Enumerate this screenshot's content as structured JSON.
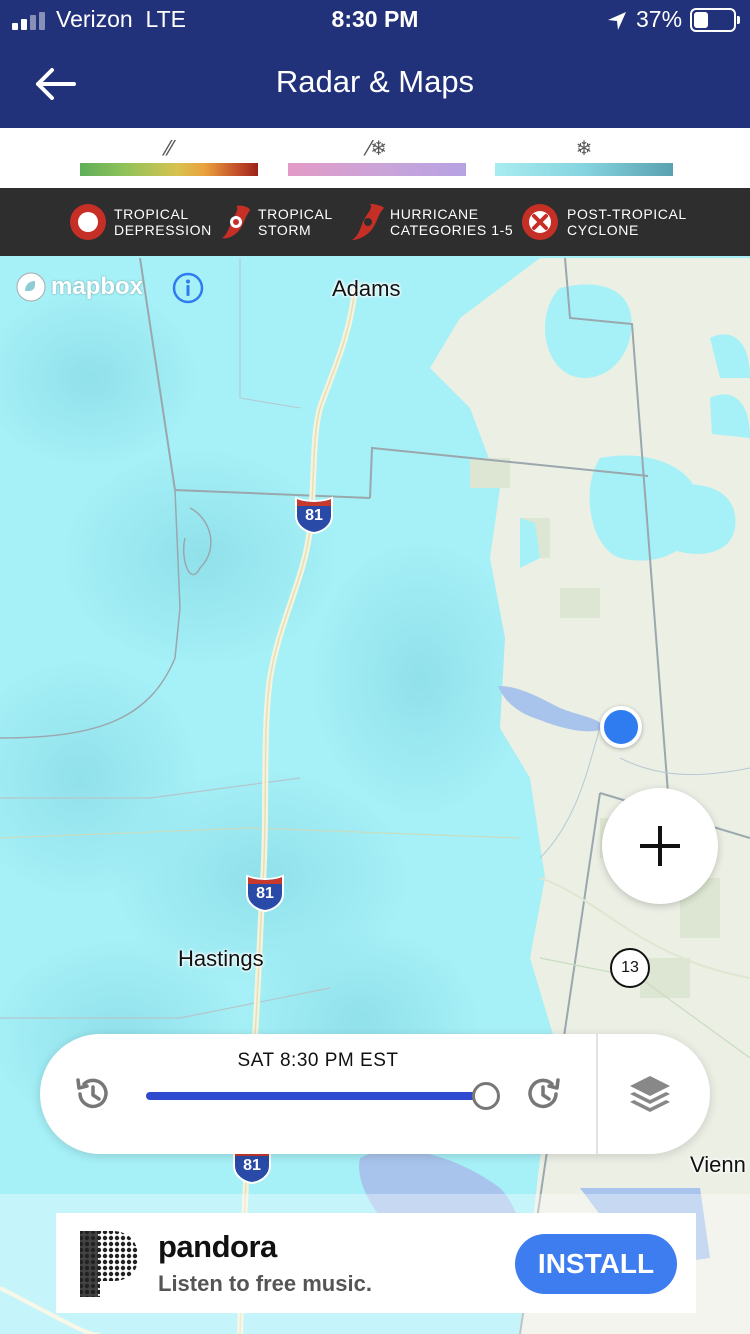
{
  "status_bar": {
    "carrier": "Verizon",
    "network": "LTE",
    "time": "8:30 PM",
    "battery": "37%"
  },
  "header": {
    "title": "Radar & Maps",
    "back_icon": "arrow-left-icon"
  },
  "precip_legend": [
    {
      "icon": "rain-icon",
      "symbol": "⁄⁄",
      "colors": [
        "#5fae5a",
        "#d8c24f",
        "#9b2319"
      ]
    },
    {
      "icon": "mix-icon",
      "symbol": "⁄❄",
      "colors": [
        "#e39ac6",
        "#b6a2e3"
      ]
    },
    {
      "icon": "snow-icon",
      "symbol": "❄",
      "colors": [
        "#a8ecf0",
        "#5aa1b1"
      ]
    }
  ],
  "storm_legend": [
    {
      "label": "TROPICAL\nDEPRESSION",
      "icon": "tropical-depression-icon"
    },
    {
      "label": "TROPICAL\nSTORM",
      "icon": "tropical-storm-icon"
    },
    {
      "label": "HURRICANE\nCATEGORIES 1-5",
      "icon": "hurricane-icon"
    },
    {
      "label": "POST-TROPICAL\nCYCLONE",
      "icon": "post-tropical-cyclone-icon"
    }
  ],
  "map": {
    "attribution": "mapbox",
    "towns": {
      "adams": "Adams",
      "hastings": "Hastings",
      "vienna": "Vienn"
    },
    "interstate": "81",
    "route": "13"
  },
  "timeline": {
    "time_label": "SAT 8:30 PM EST",
    "progress": 1.0
  },
  "ad": {
    "brand": "pandora",
    "tagline": "Listen to free music.",
    "cta": "INSTALL"
  },
  "colors": {
    "header_bg": "#21317a",
    "map_snow": "#a6f0f7",
    "land": "#ebefe4",
    "accent": "#2e4bd0",
    "location": "#2f7bf0"
  }
}
